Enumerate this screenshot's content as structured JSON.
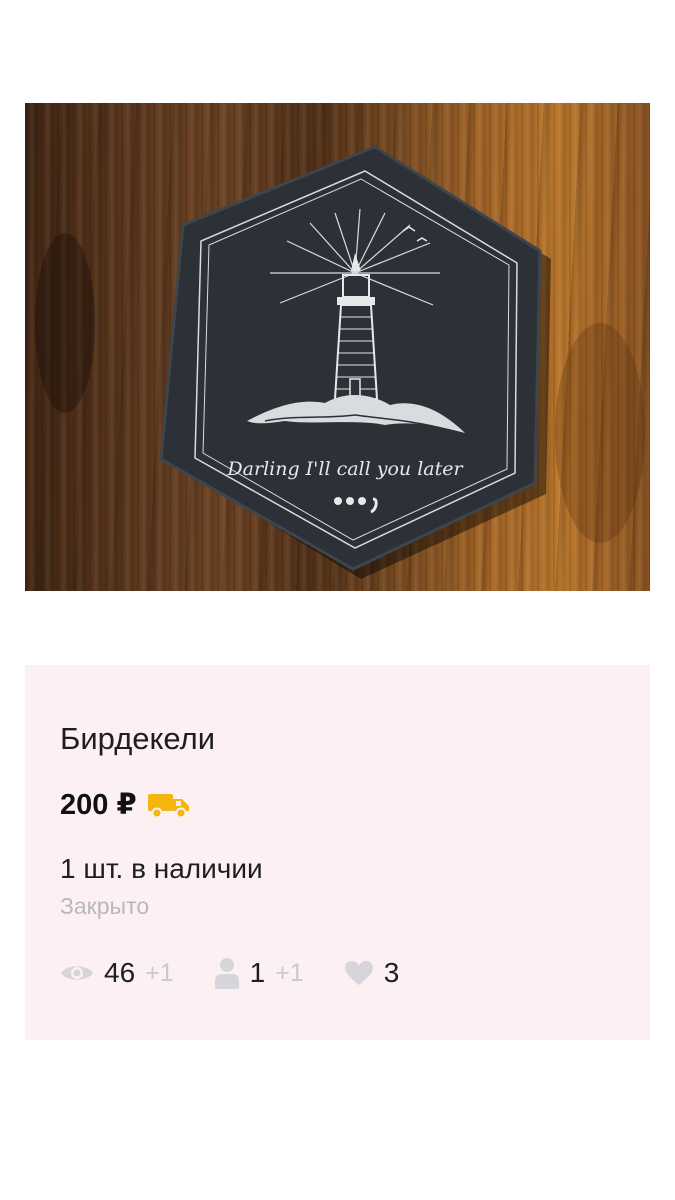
{
  "photo": {
    "alt_icon": "coaster-photo",
    "caption_script": "Darling I'll call you later",
    "icon": "lighthouse-icon"
  },
  "product": {
    "title": "Бирдекели",
    "price": "200 ₽",
    "delivery_icon": "truck-icon",
    "stock": "1 шт. в наличии",
    "status": "Закрыто"
  },
  "stats": {
    "views": "46",
    "views_delta": "+1",
    "contacts": "1",
    "contacts_delta": "+1",
    "favorites": "3"
  },
  "colors": {
    "card_bg": "#fdf0f3",
    "truck": "#f5b50f",
    "muted": "#c9c9cc"
  }
}
